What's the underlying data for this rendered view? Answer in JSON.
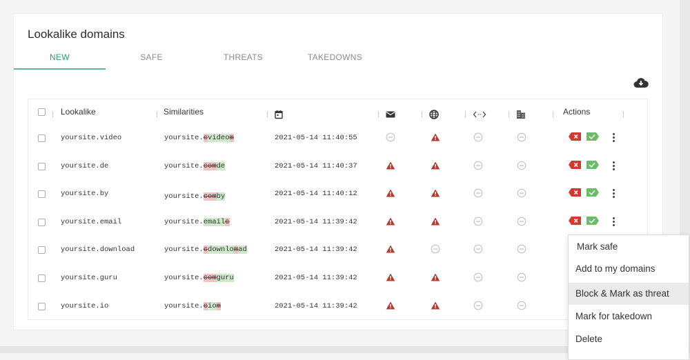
{
  "page": {
    "title": "Lookalike domains",
    "tabs": [
      {
        "label": "NEW",
        "active": true
      },
      {
        "label": "SAFE",
        "active": false
      },
      {
        "label": "THREATS",
        "active": false
      },
      {
        "label": "TAKEDOWNS",
        "active": false
      }
    ],
    "download_icon": "cloud-download-icon"
  },
  "table": {
    "columns": [
      {
        "key": "select",
        "label": "",
        "icon": "checkbox"
      },
      {
        "key": "lookalike",
        "label": "Lookalike"
      },
      {
        "key": "similarities",
        "label": "Similarities"
      },
      {
        "key": "date",
        "label": "",
        "icon": "calendar-icon"
      },
      {
        "key": "mail",
        "label": "",
        "icon": "mail-icon"
      },
      {
        "key": "web",
        "label": "",
        "icon": "globe-icon"
      },
      {
        "key": "code",
        "label": "",
        "icon": "code-icon"
      },
      {
        "key": "company",
        "label": "",
        "icon": "building-icon"
      },
      {
        "key": "actions",
        "label": "Actions"
      }
    ],
    "status_legend": {
      "threat": "warning-triangle-icon",
      "none": "minus-circle-icon"
    },
    "colors": {
      "threat": "#b03a2e",
      "none": "#c4c4c4",
      "del_bg": "#f1c4c4",
      "ins_bg": "#cfeacb",
      "reject": "#d33a2f",
      "accept": "#6dbb6a"
    },
    "rows": [
      {
        "lookalike": "yoursite.video",
        "base": "yoursite.",
        "segments": [
          {
            "t": "c",
            "k": "del"
          },
          {
            "t": "video",
            "k": "ins"
          },
          {
            "t": "m",
            "k": "del"
          }
        ],
        "date": "2021-05-14 11:40:55",
        "mail": "none",
        "web": "threat",
        "code": "none",
        "company": "none",
        "actions": true
      },
      {
        "lookalike": "yoursite.de",
        "base": "yoursite.",
        "segments": [
          {
            "t": "com",
            "k": "del"
          },
          {
            "t": "de",
            "k": "ins"
          }
        ],
        "date": "2021-05-14 11:40:37",
        "mail": "threat",
        "web": "threat",
        "code": "none",
        "company": "none",
        "actions": true
      },
      {
        "lookalike": "yoursite.by",
        "base": "yoursite.",
        "segments": [
          {
            "t": "com",
            "k": "del"
          },
          {
            "t": "by",
            "k": "ins"
          }
        ],
        "date": "2021-05-14 11:40:12",
        "mail": "threat",
        "web": "threat",
        "code": "none",
        "company": "none",
        "actions": true
      },
      {
        "lookalike": "yoursite.email",
        "base": "yoursite.",
        "segments": [
          {
            "t": "email",
            "k": "ins"
          },
          {
            "t": "c",
            "k": "del"
          }
        ],
        "date": "2021-05-14 11:39:42",
        "mail": "threat",
        "web": "threat",
        "code": "none",
        "company": "none",
        "actions": true
      },
      {
        "lookalike": "yoursite.download",
        "base": "yoursite.",
        "segments": [
          {
            "t": "c",
            "k": "del"
          },
          {
            "t": "downlo",
            "k": "ins"
          },
          {
            "t": "m",
            "k": "del"
          },
          {
            "t": "ad",
            "k": "ins"
          }
        ],
        "date": "2021-05-14 11:39:42",
        "mail": "threat",
        "web": "none",
        "code": "none",
        "company": "none",
        "actions": false
      },
      {
        "lookalike": "yoursite.guru",
        "base": "yoursite.",
        "segments": [
          {
            "t": "com",
            "k": "del"
          },
          {
            "t": "guru",
            "k": "ins"
          }
        ],
        "date": "2021-05-14 11:39:42",
        "mail": "threat",
        "web": "threat",
        "code": "none",
        "company": "none",
        "actions": false
      },
      {
        "lookalike": "yoursite.io",
        "base": "yoursite.",
        "segments": [
          {
            "t": "c",
            "k": "del"
          },
          {
            "t": "io",
            "k": "ins"
          },
          {
            "t": "m",
            "k": "del"
          }
        ],
        "date": "2021-05-14 11:39:42",
        "mail": "threat",
        "web": "threat",
        "code": "none",
        "company": "none",
        "actions": false
      }
    ]
  },
  "context_menu": {
    "items": [
      {
        "label": "Mark safe",
        "highlighted": false
      },
      {
        "label": "Add to my domains",
        "highlighted": false
      },
      {
        "label": "Block & Mark as threat",
        "highlighted": true
      },
      {
        "label": "Mark for takedown",
        "highlighted": false
      },
      {
        "label": "Delete",
        "highlighted": false
      }
    ]
  }
}
